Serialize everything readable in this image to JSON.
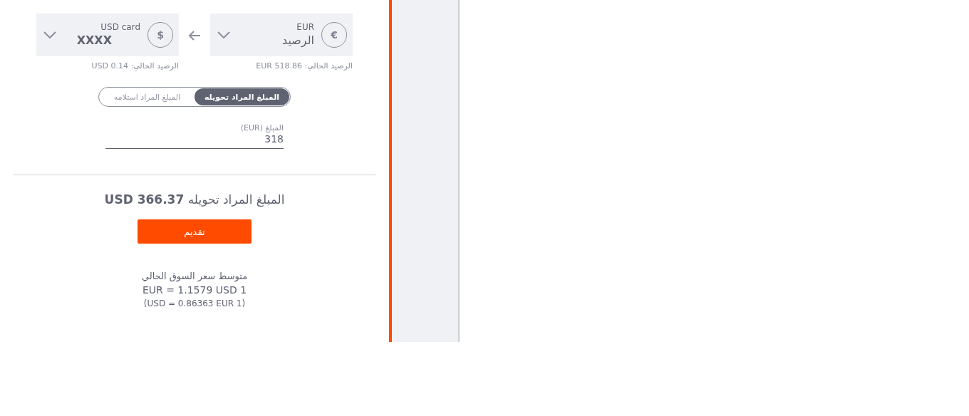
{
  "from": {
    "currency": "EUR",
    "name": "الرصيد",
    "symbol": "€",
    "balance": "الرصيد الحالي: EUR 518.86"
  },
  "to": {
    "currency": "USD card",
    "name": "XXXX",
    "symbol": "$",
    "balance": "الرصيد الحالي: USD 0.14"
  },
  "mode_tabs": [
    {
      "label": "المبلغ المراد تحويله",
      "selected": true
    },
    {
      "label": "المبلغ المراد استلامه",
      "selected": false
    }
  ],
  "amount": {
    "label": "المبلغ (EUR)",
    "value": "318"
  },
  "result": "المبلغ المراد تحويله **USD 366.37**",
  "submit": "تقديم",
  "rate": {
    "title": "متوسط سعر السوق الحالي",
    "line_1": "EUR = 1.1579 USD 1",
    "line_2": "(USD = 0.86363 EUR 1)"
  }
}
